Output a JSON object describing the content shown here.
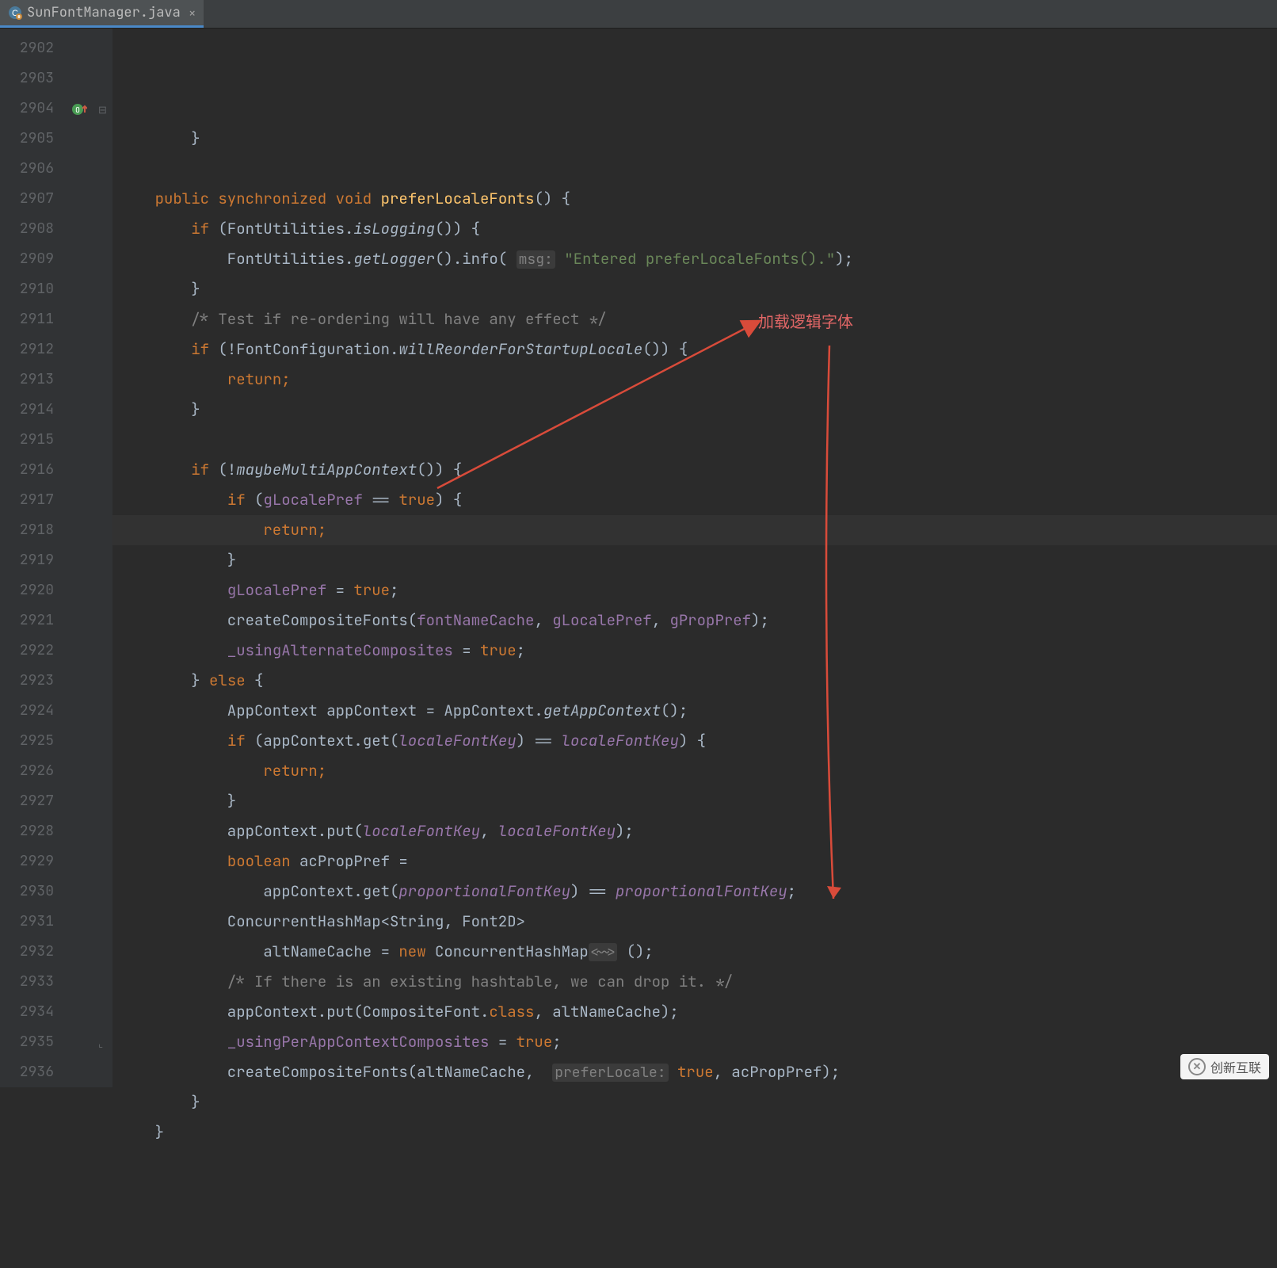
{
  "tab": {
    "filename": "SunFontManager.java",
    "close": "×"
  },
  "annotation": {
    "label": "加载逻辑字体"
  },
  "watermark": "创新互联",
  "lines": [
    {
      "n": "2902",
      "html": "        }"
    },
    {
      "n": "2903",
      "html": ""
    },
    {
      "n": "2904",
      "html": "    <span class='kw'>public synchronized void</span> <span class='mname'>preferLocaleFonts</span>() {",
      "marker": "override"
    },
    {
      "n": "2905",
      "html": "        <span class='kw'>if</span> (FontUtilities.<span class='it'>isLogging</span>()) {"
    },
    {
      "n": "2906",
      "html": "            FontUtilities.<span class='it'>getLogger</span>().info( <span class='param'>msg:</span> <span class='str'>\"Entered preferLocaleFonts().\"</span>);"
    },
    {
      "n": "2907",
      "html": "        }"
    },
    {
      "n": "2908",
      "html": "        <span class='cmt'>/* Test if re-ordering will have any effect */</span>"
    },
    {
      "n": "2909",
      "html": "        <span class='kw'>if</span> (!FontConfiguration.<span class='it'>willReorderForStartupLocale</span>()) {"
    },
    {
      "n": "2910",
      "html": "            <span class='kw'>return;</span>"
    },
    {
      "n": "2911",
      "html": "        }"
    },
    {
      "n": "2912",
      "html": ""
    },
    {
      "n": "2913",
      "html": "        <span class='kw'>if</span> (!<span class='it'>maybeMultiAppContext</span>()) {"
    },
    {
      "n": "2914",
      "html": "            <span class='kw'>if</span> (<span class='field'>gLocalePref</span> == <span class='kw'>true</span>) {"
    },
    {
      "n": "2915",
      "html": "                <span class='kw'>return;</span>",
      "hl": true
    },
    {
      "n": "2916",
      "html": "            }"
    },
    {
      "n": "2917",
      "html": "            <span class='field'>gLocalePref</span> = <span class='kw'>true</span>;"
    },
    {
      "n": "2918",
      "html": "            createCompositeFonts(<span class='field'>fontNameCache</span>, <span class='field'>gLocalePref</span>, <span class='field'>gPropPref</span>);"
    },
    {
      "n": "2919",
      "html": "            <span class='field'>_usingAlternateComposites</span> = <span class='kw'>true</span>;"
    },
    {
      "n": "2920",
      "html": "        } <span class='kw'>else</span> {"
    },
    {
      "n": "2921",
      "html": "            AppContext appContext = AppContext.<span class='it'>getAppContext</span>();"
    },
    {
      "n": "2922",
      "html": "            <span class='kw'>if</span> (appContext.get(<span class='itfield'>localeFontKey</span>) == <span class='itfield'>localeFontKey</span>) {"
    },
    {
      "n": "2923",
      "html": "                <span class='kw'>return;</span>"
    },
    {
      "n": "2924",
      "html": "            }"
    },
    {
      "n": "2925",
      "html": "            appContext.put(<span class='itfield'>localeFontKey</span>, <span class='itfield'>localeFontKey</span>);"
    },
    {
      "n": "2926",
      "html": "            <span class='kw'>boolean</span> acPropPref ="
    },
    {
      "n": "2927",
      "html": "                appContext.get(<span class='itfield'>proportionalFontKey</span>) == <span class='itfield'>proportionalFontKey</span>;"
    },
    {
      "n": "2928",
      "html": "            ConcurrentHashMap&lt;String, Font2D&gt;"
    },
    {
      "n": "2929",
      "html": "                altNameCache = <span class='kw'>new</span> ConcurrentHashMap<span class='generic'>&lt;~&gt;</span> ();"
    },
    {
      "n": "2930",
      "html": "            <span class='cmt'>/* If there is an existing hashtable, we can drop it. */</span>"
    },
    {
      "n": "2931",
      "html": "            appContext.put(CompositeFont.<span class='kw'>class</span>, altNameCache);"
    },
    {
      "n": "2932",
      "html": "            <span class='field'>_usingPerAppContextComposites</span> = <span class='kw'>true</span>;"
    },
    {
      "n": "2933",
      "html": "            createCompositeFonts(altNameCache,  <span class='param'>preferLocale:</span> <span class='kw'>true</span>, acPropPref);"
    },
    {
      "n": "2934",
      "html": "        }"
    },
    {
      "n": "2935",
      "html": "    }"
    },
    {
      "n": "2936",
      "html": ""
    }
  ]
}
